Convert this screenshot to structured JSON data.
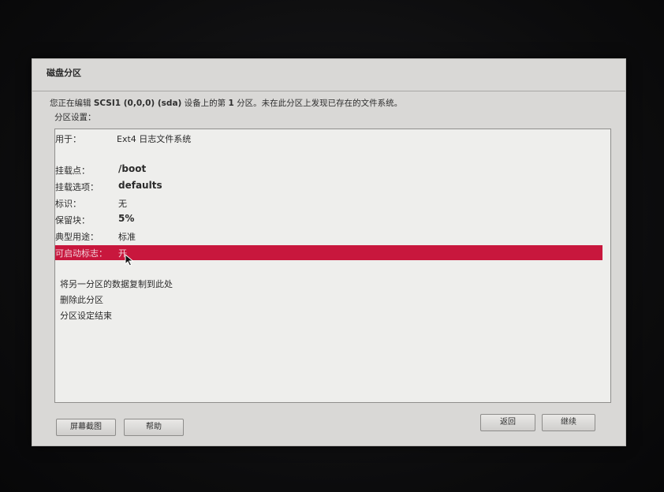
{
  "dialog": {
    "title": "磁盘分区",
    "message_prefix": "您正在编辑 ",
    "message_device": "SCSI1 (0,0,0) (sda)",
    "message_mid": " 设备上的第 ",
    "message_num": "1",
    "message_suffix": " 分区。未在此分区上发现已存在的文件系统。",
    "subtitle": "分区设置："
  },
  "settings": [
    {
      "label": "用于：",
      "value": "Ext4 日志文件系统"
    },
    {
      "label": "挂载点：",
      "value": "/boot"
    },
    {
      "label": "挂载选项：",
      "value": "defaults"
    },
    {
      "label": "标识：",
      "value": "无"
    },
    {
      "label": "保留块：",
      "value": "5%"
    },
    {
      "label": "典型用途：",
      "value": "标准"
    },
    {
      "label": "可启动标志：",
      "value": "开"
    }
  ],
  "actions": [
    "将另一分区的数据复制到此处",
    "删除此分区",
    "分区设定结束"
  ],
  "buttons": {
    "screenshot": "屏幕截图",
    "help": "帮助",
    "back": "返回",
    "continue": "继续"
  },
  "colors": {
    "selection": "#c8173d",
    "dialog_bg": "#d9d8d6",
    "list_bg": "#eeeeec"
  },
  "icons": {
    "cursor": "mouse-pointer-icon"
  }
}
